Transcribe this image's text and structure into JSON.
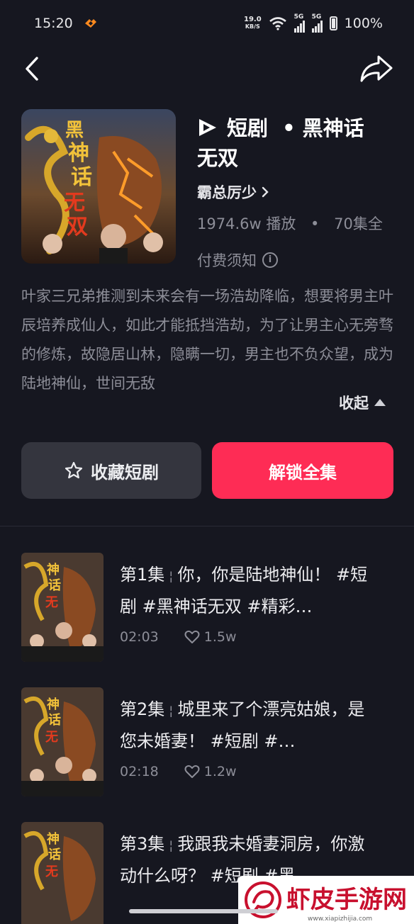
{
  "status_bar": {
    "time": "15:20",
    "net_speed_value": "19.0",
    "net_speed_unit": "KB/S",
    "sim1_label": "5G",
    "sim2_label": "5G",
    "battery": "100%"
  },
  "drama": {
    "brand": "短剧",
    "dot": "•",
    "name_line1": "黑神话",
    "name_line2": "无双",
    "author": "霸总厉少",
    "plays": "1974.6w 播放",
    "stats_dot": "•",
    "episodes_total": "70集全",
    "notice": "付费须知",
    "description": "叶家三兄弟推测到未来会有一场浩劫降临，想要将男主叶辰培养成仙人，如此才能抵挡浩劫，为了让男主心无旁骛的修炼，故隐居山林，隐瞒一切，男主也不负众望，成为陆地神仙，世间无敌",
    "collapse": "收起"
  },
  "actions": {
    "favorite": "收藏短剧",
    "unlock": "解锁全集"
  },
  "episodes": [
    {
      "number": "第1集",
      "sep": "¦",
      "title": "你，你是陆地神仙！ #短剧 #黑神话无双 #精彩…",
      "duration": "02:03",
      "likes": "1.5w"
    },
    {
      "number": "第2集",
      "sep": "¦",
      "title": "城里来了个漂亮姑娘，是您未婚妻！ #短剧 #…",
      "duration": "02:18",
      "likes": "1.2w"
    },
    {
      "number": "第3集",
      "sep": "¦",
      "title": "我跟我未婚妻洞房，你激动什么呀？ #短剧 #黑…",
      "duration": "",
      "likes": ""
    }
  ],
  "watermark": {
    "text": "虾皮手游网",
    "url": "www.xiapizhijia.com"
  },
  "colors": {
    "background": "#161720",
    "accent": "#fe2c55",
    "secondary_button": "#34353e",
    "muted_text": "#8d8e98"
  },
  "icons": [
    "back-icon",
    "share-icon",
    "douyin-drama-logo-icon",
    "chevron-right-icon",
    "info-icon",
    "star-icon",
    "heart-icon",
    "caret-up-icon"
  ]
}
